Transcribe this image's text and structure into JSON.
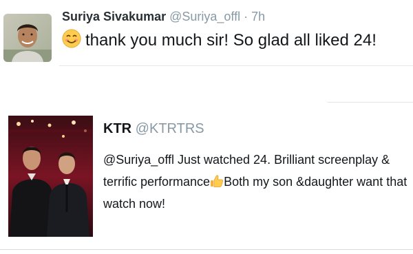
{
  "tweets": [
    {
      "name": "Suriya Sivakumar",
      "handle": "@Suriya_offl",
      "separator": "·",
      "time": "7h",
      "text": "thank you much sir! So glad all liked 24!",
      "emoji": "smiling-face-emoji"
    },
    {
      "name": "KTR",
      "handle": "@KTRTRS",
      "text_part1": "@Suriya_offl Just watched 24. Brilliant screenplay & terrific performance",
      "text_part2": "Both my son &daughter want that watch now!",
      "emoji": "thumbs-up-emoji"
    }
  ],
  "colors": {
    "handle": "#8899a6",
    "text": "#14171a",
    "divider": "#e1e8ed"
  }
}
